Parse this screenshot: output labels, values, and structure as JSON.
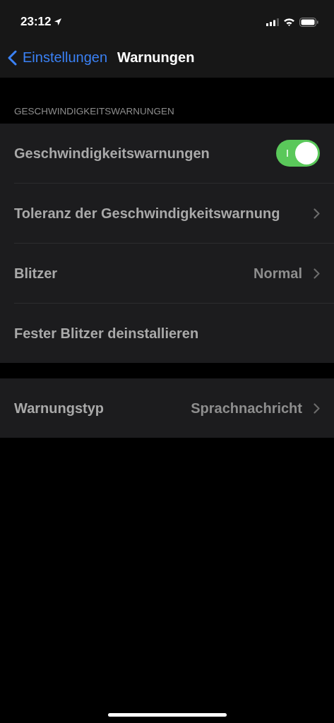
{
  "status_bar": {
    "time": "23:12"
  },
  "nav": {
    "back": "Einstellungen",
    "title": "Warnungen"
  },
  "sections": [
    {
      "header": "GESCHWINDIGKEITSWARNUNGEN",
      "rows": [
        {
          "kind": "toggle",
          "label": "Geschwindigkeitswarnungen",
          "on": true
        },
        {
          "kind": "nav",
          "label": "Toleranz der Geschwindigkeitswarnung"
        },
        {
          "kind": "nav",
          "label": "Blitzer",
          "value": "Normal"
        },
        {
          "kind": "action",
          "label": "Fester Blitzer deinstallieren"
        }
      ]
    },
    {
      "rows": [
        {
          "kind": "nav",
          "label": "Warnungstyp",
          "value": "Sprachnachricht"
        }
      ]
    }
  ]
}
